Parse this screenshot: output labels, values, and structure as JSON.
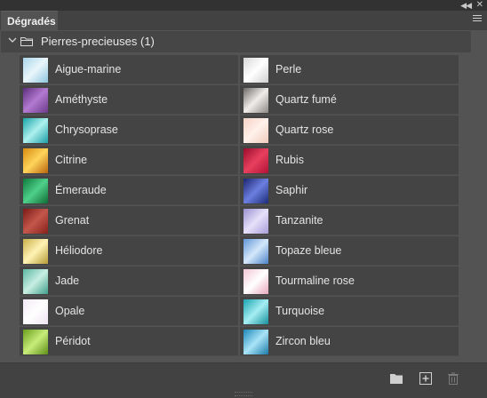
{
  "panel": {
    "tab_title": "Dégradés",
    "group_label": "Pierres-precieuses (1)"
  },
  "gradients": [
    {
      "label": "Aigue-marine",
      "colors": [
        "#a9d6ea",
        "#e9f6fb",
        "#8cc4dd"
      ]
    },
    {
      "label": "Perle",
      "colors": [
        "#d8d8d8",
        "#ffffff",
        "#cfcfcf"
      ]
    },
    {
      "label": "Améthyste",
      "colors": [
        "#5d2e7d",
        "#b37ad1",
        "#6a3a8a"
      ]
    },
    {
      "label": "Quartz fumé",
      "colors": [
        "#6e6a68",
        "#efecea",
        "#8e8986"
      ]
    },
    {
      "label": "Chrysoprase",
      "colors": [
        "#19a4a8",
        "#aef0ee",
        "#1a9ea6"
      ]
    },
    {
      "label": "Quartz rose",
      "colors": [
        "#f5d2c5",
        "#fff1ea",
        "#efc9bb"
      ]
    },
    {
      "label": "Citrine",
      "colors": [
        "#d88a10",
        "#ffd45a",
        "#b8650c"
      ]
    },
    {
      "label": "Rubis",
      "colors": [
        "#9a0c2c",
        "#e8405e",
        "#b01236"
      ]
    },
    {
      "label": "Émeraude",
      "colors": [
        "#0e7a3a",
        "#4fd08a",
        "#0e6b33"
      ]
    },
    {
      "label": "Saphir",
      "colors": [
        "#1b256e",
        "#6c7fe0",
        "#1c2a78"
      ]
    },
    {
      "label": "Grenat",
      "colors": [
        "#7a1a16",
        "#c4574c",
        "#86201a"
      ]
    },
    {
      "label": "Tanzanite",
      "colors": [
        "#9a8fd0",
        "#e6e1fa",
        "#a89cd8"
      ]
    },
    {
      "label": "Héliodore",
      "colors": [
        "#c9b04a",
        "#fff3b5",
        "#b49a35"
      ]
    },
    {
      "label": "Topaze bleue",
      "colors": [
        "#5f95d6",
        "#d5e8fb",
        "#4a82c8"
      ]
    },
    {
      "label": "Jade",
      "colors": [
        "#5ab7a2",
        "#c8eee2",
        "#3f9e8b"
      ]
    },
    {
      "label": "Tourmaline rose",
      "colors": [
        "#f2c6d4",
        "#ffffff",
        "#e8a8bd"
      ]
    },
    {
      "label": "Opale",
      "colors": [
        "#f3e9f6",
        "#ffffff",
        "#efe3f2"
      ]
    },
    {
      "label": "Turquoise",
      "colors": [
        "#1aa3b0",
        "#a5eef2",
        "#158f9c"
      ]
    },
    {
      "label": "Péridot",
      "colors": [
        "#6a9e1c",
        "#c8ec7a",
        "#5d8e16"
      ]
    },
    {
      "label": "Zircon bleu",
      "colors": [
        "#1d88b8",
        "#a9e4f7",
        "#1a7aa8"
      ]
    }
  ]
}
